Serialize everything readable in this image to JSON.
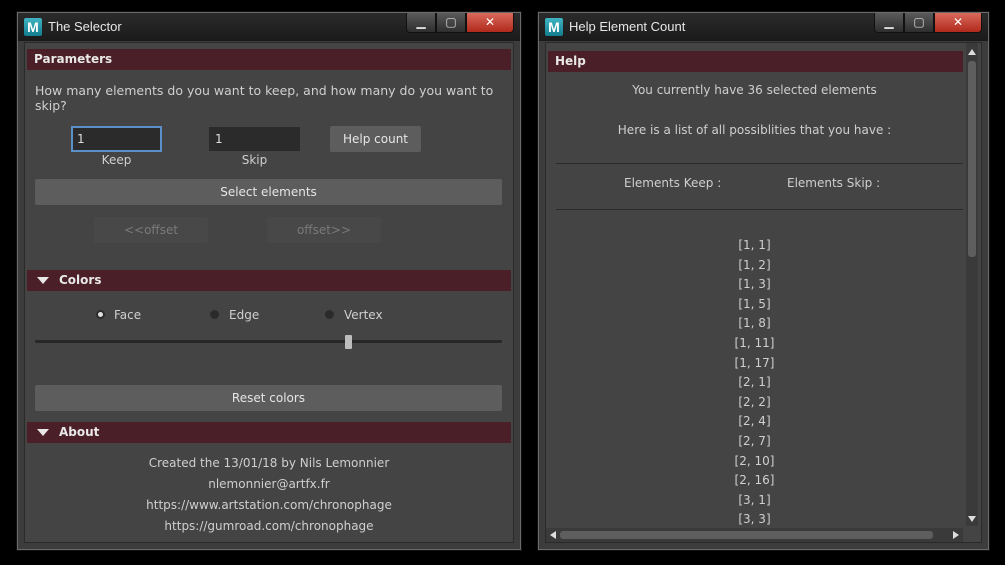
{
  "selector": {
    "title": "The Selector",
    "logo": "M",
    "window_buttons": {
      "minimize": "▁",
      "maximize": "▢",
      "close": "✕"
    },
    "parameters": {
      "header": "Parameters",
      "question": "How many elements do you want to keep, and how many do you want to skip?",
      "keep_value": "1",
      "keep_label": "Keep",
      "skip_value": "1",
      "skip_label": "Skip",
      "help_count": "Help count",
      "select_elements": "Select elements",
      "offset_prev": "<<offset",
      "offset_next": "offset>>"
    },
    "colors": {
      "header": "Colors",
      "options": [
        "Face",
        "Edge",
        "Vertex"
      ],
      "selected": "Face",
      "slider_fraction": 0.67,
      "reset": "Reset colors"
    },
    "about": {
      "header": "About",
      "lines": [
        "Created the 13/01/18 by Nils Lemonnier",
        "nlemonnier@artfx.fr",
        "https://www.artstation.com/chronophage",
        "https://gumroad.com/chronophage"
      ]
    }
  },
  "help": {
    "title": "Help Element Count",
    "logo": "M",
    "window_buttons": {
      "minimize": "▁",
      "maximize": "▢",
      "close": "✕"
    },
    "header": "Help",
    "selected_text": "You currently have 36 selected elements",
    "list_intro": "Here is a list of all possiblities that you have :",
    "col_keep": "Elements Keep :",
    "col_skip": "Elements Skip :",
    "items": [
      "[1, 1]",
      "[1, 2]",
      "[1, 3]",
      "[1, 5]",
      "[1, 8]",
      "[1, 11]",
      "[1, 17]",
      "[2, 1]",
      "[2, 2]",
      "[2, 4]",
      "[2, 7]",
      "[2, 10]",
      "[2, 16]",
      "[3, 1]",
      "[3, 3]"
    ]
  },
  "colors": {
    "section_bg": "#4a1f27",
    "focus": "#5b8fc7",
    "logo": "#1a96a8",
    "close": "#c0392b"
  }
}
